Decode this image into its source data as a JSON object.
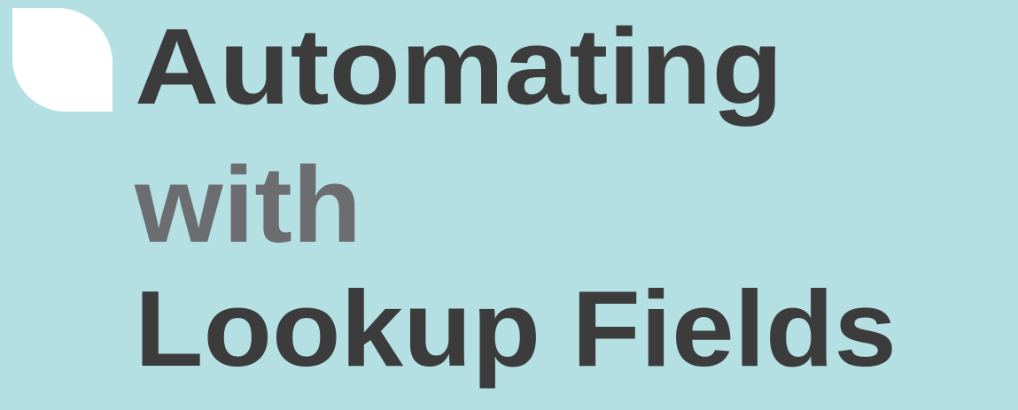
{
  "title": {
    "line1": "Automating",
    "line2": "with",
    "line3": "Lookup Fields"
  },
  "colors": {
    "background": "#b5e0e3",
    "leaf": "#ffffff",
    "title_dark": "#3c3c3c",
    "title_gray": "#6c6d70"
  }
}
